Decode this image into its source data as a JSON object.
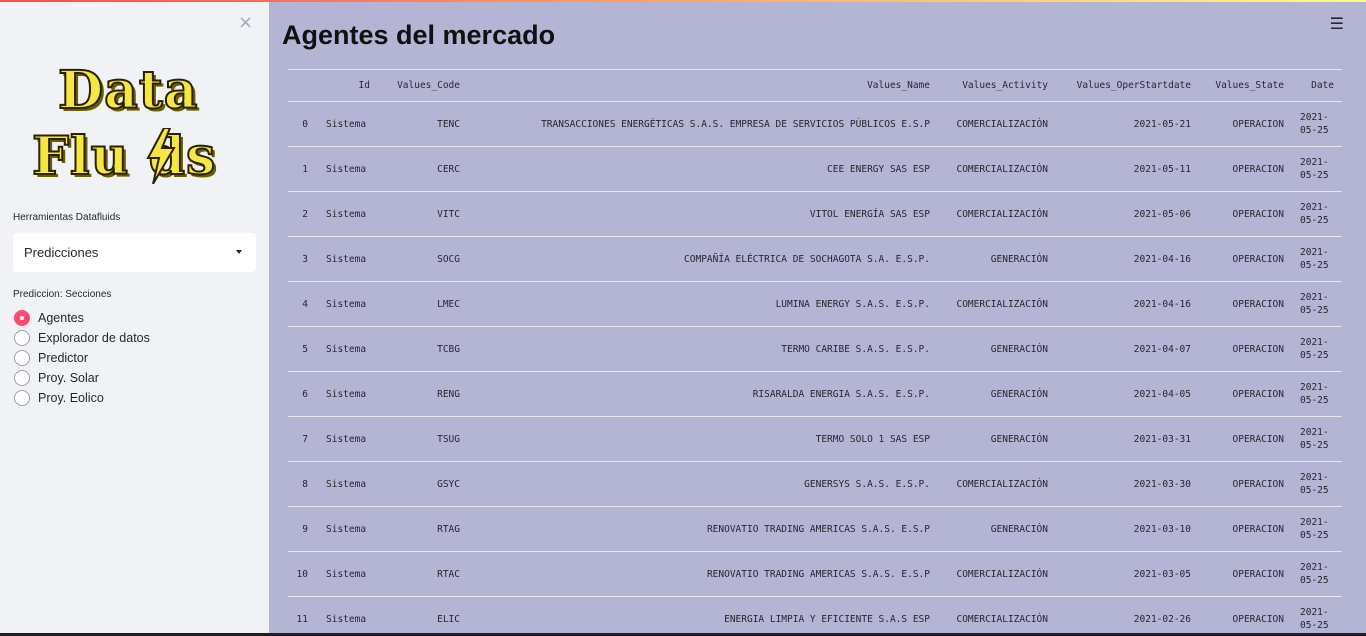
{
  "sidebar": {
    "close_icon": "×",
    "logo": {
      "line1": "Data",
      "line2": "Flu  ds"
    },
    "tools_label": "Herramientas Datafluids",
    "select_value": "Predicciones",
    "sections_label": "Prediccion: Secciones",
    "options": [
      {
        "label": "Agentes",
        "checked": true
      },
      {
        "label": "Explorador de datos",
        "checked": false
      },
      {
        "label": "Predictor",
        "checked": false
      },
      {
        "label": "Proy. Solar",
        "checked": false
      },
      {
        "label": "Proy. Eolico",
        "checked": false
      }
    ]
  },
  "main": {
    "menu_icon": "☰",
    "title": "Agentes del mercado",
    "columns": [
      "",
      "Id",
      "Values_Code",
      "Values_Name",
      "Values_Activity",
      "Values_OperStartdate",
      "Values_State",
      "Date"
    ],
    "rows": [
      [
        "0",
        "Sistema",
        "TENC",
        "TRANSACCIONES ENERGÉTICAS S.A.S. EMPRESA DE SERVICIOS PÚBLICOS E.S.P",
        "COMERCIALIZACIÓN",
        "2021-05-21",
        "OPERACION",
        "2021-05-25"
      ],
      [
        "1",
        "Sistema",
        "CERC",
        "CEE ENERGY SAS ESP",
        "COMERCIALIZACIÓN",
        "2021-05-11",
        "OPERACION",
        "2021-05-25"
      ],
      [
        "2",
        "Sistema",
        "VITC",
        "VITOL ENERGÍA SAS ESP",
        "COMERCIALIZACIÓN",
        "2021-05-06",
        "OPERACION",
        "2021-05-25"
      ],
      [
        "3",
        "Sistema",
        "SOCG",
        "COMPAÑÍA ELÉCTRICA DE SOCHAGOTA S.A. E.S.P.",
        "GENERACIÓN",
        "2021-04-16",
        "OPERACION",
        "2021-05-25"
      ],
      [
        "4",
        "Sistema",
        "LMEC",
        "LUMINA ENERGY S.A.S. E.S.P.",
        "COMERCIALIZACIÓN",
        "2021-04-16",
        "OPERACION",
        "2021-05-25"
      ],
      [
        "5",
        "Sistema",
        "TCBG",
        "TERMO CARIBE S.A.S. E.S.P.",
        "GENERACIÓN",
        "2021-04-07",
        "OPERACION",
        "2021-05-25"
      ],
      [
        "6",
        "Sistema",
        "RENG",
        "RISARALDA ENERGIA S.A.S. E.S.P.",
        "GENERACIÓN",
        "2021-04-05",
        "OPERACION",
        "2021-05-25"
      ],
      [
        "7",
        "Sistema",
        "TSUG",
        "TERMO SOLO 1 SAS ESP",
        "GENERACIÓN",
        "2021-03-31",
        "OPERACION",
        "2021-05-25"
      ],
      [
        "8",
        "Sistema",
        "GSYC",
        "GENERSYS S.A.S. E.S.P.",
        "COMERCIALIZACIÓN",
        "2021-03-30",
        "OPERACION",
        "2021-05-25"
      ],
      [
        "9",
        "Sistema",
        "RTAG",
        "RENOVATIO TRADING AMERICAS S.A.S. E.S.P",
        "GENERACIÓN",
        "2021-03-10",
        "OPERACION",
        "2021-05-25"
      ],
      [
        "10",
        "Sistema",
        "RTAC",
        "RENOVATIO TRADING AMERICAS S.A.S. E.S.P",
        "COMERCIALIZACIÓN",
        "2021-03-05",
        "OPERACION",
        "2021-05-25"
      ],
      [
        "11",
        "Sistema",
        "ELIC",
        "ENERGIA LIMPIA Y EFICIENTE S.A.S ESP",
        "COMERCIALIZACIÓN",
        "2021-02-26",
        "OPERACION",
        "2021-05-25"
      ]
    ]
  }
}
